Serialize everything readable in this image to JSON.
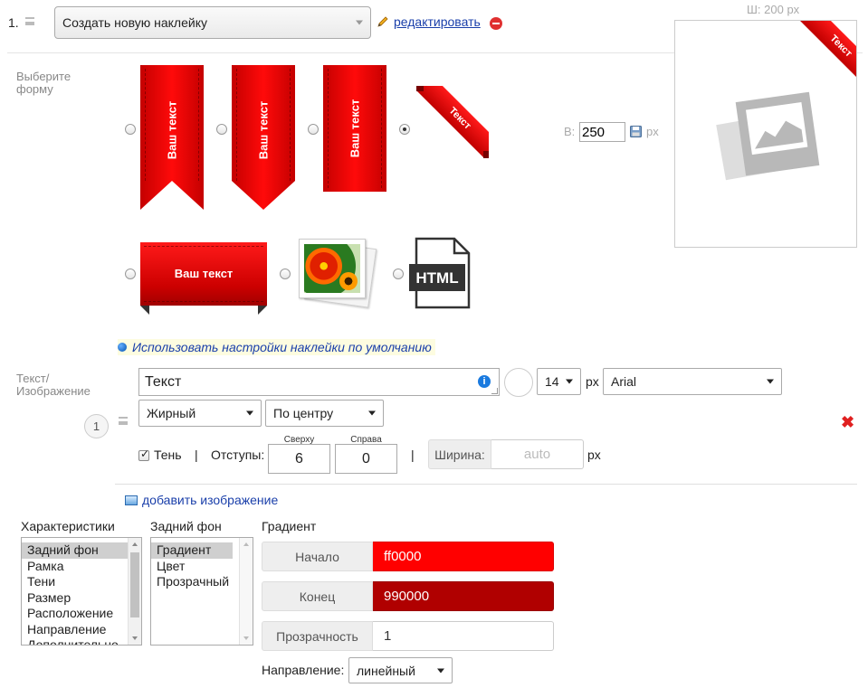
{
  "header": {
    "row_number": "1.",
    "sticker_select": "Создать новую наклейку",
    "edit_link": "редактировать"
  },
  "shape_section": {
    "label": "Выберите форму",
    "ribbon_text": "Ваш текст",
    "corner_text": "Текст",
    "horizontal_text": "Ваш текст",
    "html_label": "HTML"
  },
  "dimensions": {
    "width_label": "Ш: 200 px",
    "height_prefix": "В:",
    "height_value": "250",
    "height_unit": "px"
  },
  "preview": {
    "corner_text": "Текст"
  },
  "defaults_link": "Использовать настройки наклейки по умолчанию",
  "text_section": {
    "label": "Текст/ Изображение",
    "item_number": "1",
    "text_value": "Текст",
    "font_size": "14",
    "font_unit": "px",
    "font_family": "Arial",
    "font_weight": "Жирный",
    "alignment": "По центру",
    "shadow_label": "Тень",
    "separator": "|",
    "padding_label": "Отступы:",
    "top_label": "Сверху",
    "top_value": "6",
    "right_label": "Справа",
    "right_value": "0",
    "width_label": "Ширина:",
    "width_placeholder": "auto",
    "width_unit": "px",
    "add_image": "добавить изображение"
  },
  "properties": {
    "characteristics_title": "Характеристики",
    "characteristics": [
      "Задний фон",
      "Рамка",
      "Тени",
      "Размер",
      "Расположение",
      "Направление",
      "Дополнительно"
    ],
    "background_title": "Задний фон",
    "background_options": [
      "Градиент",
      "Цвет",
      "Прозрачный"
    ],
    "gradient_title": "Градиент",
    "start_label": "Начало",
    "start_value": "ff0000",
    "start_color": "#ff0000",
    "end_label": "Конец",
    "end_value": "990000",
    "end_color": "#b00000",
    "opacity_label": "Прозрачность",
    "opacity_value": "1",
    "direction_label": "Направление:",
    "direction_value": "линейный"
  }
}
